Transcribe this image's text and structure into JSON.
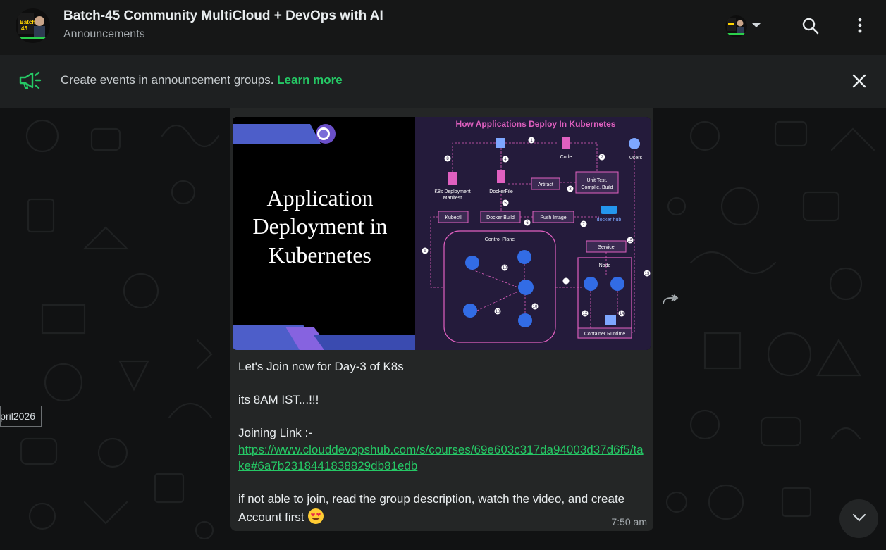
{
  "header": {
    "title": "Batch-45 Community MultiCloud + DevOps with AI",
    "subtitle": "Announcements",
    "avatar_text": "Batch 45"
  },
  "banner": {
    "text": "Create events in announcement groups.",
    "learn_more": "Learn more"
  },
  "message": {
    "poster": {
      "left_title_lines": [
        "Application",
        "Deployment in",
        "Kubernetes"
      ],
      "diagram_title": "How Applications Deploy In Kubernetes",
      "labels": {
        "code": "Code",
        "users": "Users",
        "unit_test": "Unit Test,",
        "compile": "Complie, Build",
        "artifact": "Artifact",
        "k8s_manifest_1": "K8s Deployment",
        "k8s_manifest_2": "Manifest",
        "dockerfile": "DockerFile",
        "kubectl": "Kubectl",
        "docker_build": "Docker Build",
        "push_image": "Push Image",
        "docker_hub": "docker hub",
        "control_plane": "Control Plane",
        "service": "Service",
        "node": "Node",
        "container_runtime": "Container Runtime"
      },
      "steps": [
        "1",
        "2",
        "3",
        "4",
        "5",
        "6",
        "7",
        "8",
        "9",
        "10",
        "10",
        "10",
        "11",
        "12",
        "13",
        "14",
        "15"
      ]
    },
    "lines": {
      "l1": "Let's Join now for Day-3 of K8s",
      "l2": "its 8AM IST...!!!",
      "l3": "Joining Link :-",
      "link": "https://www.clouddevopshub.com/s/courses/69e603c317da94003d37d6f5/take#6a7b2318441838829db81edb",
      "l4": "if not able to join, read the group description, watch the video, and create Account first"
    },
    "time": "7:50 am"
  },
  "date_chip": "pril2026",
  "colors": {
    "accent_green": "#25c865",
    "bubble": "#242626",
    "header_bg": "#161717"
  }
}
